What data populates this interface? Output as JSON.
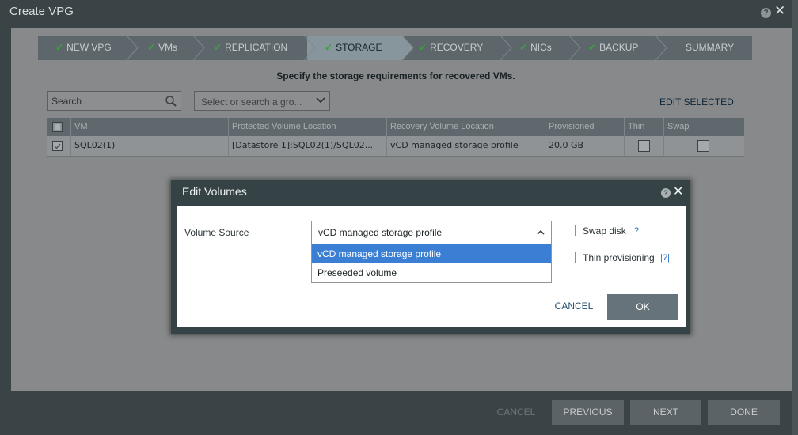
{
  "window": {
    "title": "Create VPG",
    "help": "?",
    "close": "✕"
  },
  "wizard": {
    "steps": [
      {
        "label": "NEW VPG",
        "done": true
      },
      {
        "label": "VMs",
        "done": true
      },
      {
        "label": "REPLICATION",
        "done": true
      },
      {
        "label": "STORAGE",
        "done": true,
        "active": true
      },
      {
        "label": "RECOVERY",
        "done": true
      },
      {
        "label": "NICs",
        "done": true
      },
      {
        "label": "BACKUP",
        "done": true
      },
      {
        "label": "SUMMARY",
        "done": false
      }
    ],
    "check_glyph": "✓"
  },
  "instruction": "Specify the storage requirements for recovered VMs.",
  "toolbar": {
    "search_placeholder": "Search",
    "group_placeholder": "Select or search a gro...",
    "edit_selected": "EDIT SELECTED"
  },
  "grid": {
    "columns": [
      "VM",
      "Protected Volume Location",
      "Recovery Volume Location",
      "Provisioned",
      "Thin",
      "Swap"
    ],
    "rows": [
      {
        "vm": "SQL02(1)",
        "protected": "[Datastore 1]:SQL02(1)/SQL02...",
        "recovery": "vCD managed storage profile",
        "provisioned": "20.0 GB",
        "thin": false,
        "swap": false,
        "selected": true
      }
    ]
  },
  "footer": {
    "cancel": "CANCEL",
    "previous": "PREVIOUS",
    "next": "NEXT",
    "done": "DONE"
  },
  "modal": {
    "title": "Edit Volumes",
    "help": "?",
    "close": "✕",
    "volume_source_label": "Volume Source",
    "volume_source_value": "vCD managed storage profile",
    "options": [
      "vCD managed storage profile",
      "Preseeded volume"
    ],
    "selected_option": "vCD managed storage profile",
    "swap_disk_label": "Swap disk",
    "thin_provisioning_label": "Thin provisioning",
    "help_link": "|?|",
    "cancel": "CANCEL",
    "ok": "OK",
    "colors": {
      "selected_option": "#3b7fd4",
      "link": "#2e6fbd"
    }
  }
}
